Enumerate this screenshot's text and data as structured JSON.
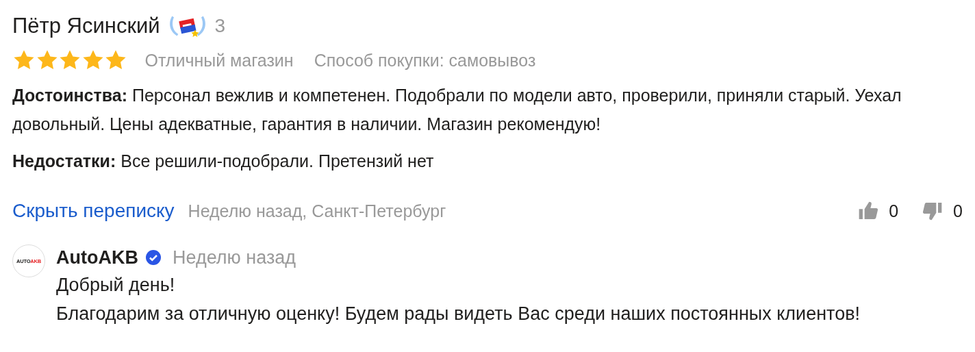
{
  "review": {
    "author": "Пётр Ясинский",
    "author_level": "3",
    "stars": 5,
    "verdict": "Отличный магазин",
    "purchase_method": "Способ покупки: самовывоз",
    "sections": [
      {
        "label": "Достоинства:",
        "text": "Персонал вежлив и компетенен. Подобрали по модели авто, проверили, приняли старый. Уехал довольный. Цены адекватные, гарантия в наличии. Магазин рекомендую!"
      },
      {
        "label": "Недостатки:",
        "text": "Все решили-подобрали. Претензий нет"
      }
    ],
    "toggle_link": "Скрыть переписку",
    "meta": "Неделю назад, Санкт-Петербург",
    "likes": "0",
    "dislikes": "0"
  },
  "reply": {
    "avatar": {
      "text_dark": "AUTO",
      "text_accent": "AKB"
    },
    "author": "AutoAKB",
    "verified": true,
    "time": "Неделю назад",
    "lines": [
      "Добрый день!",
      "Благодарим за отличную оценку! Будем рады видеть Вас среди наших постоянных клиентов!"
    ]
  }
}
